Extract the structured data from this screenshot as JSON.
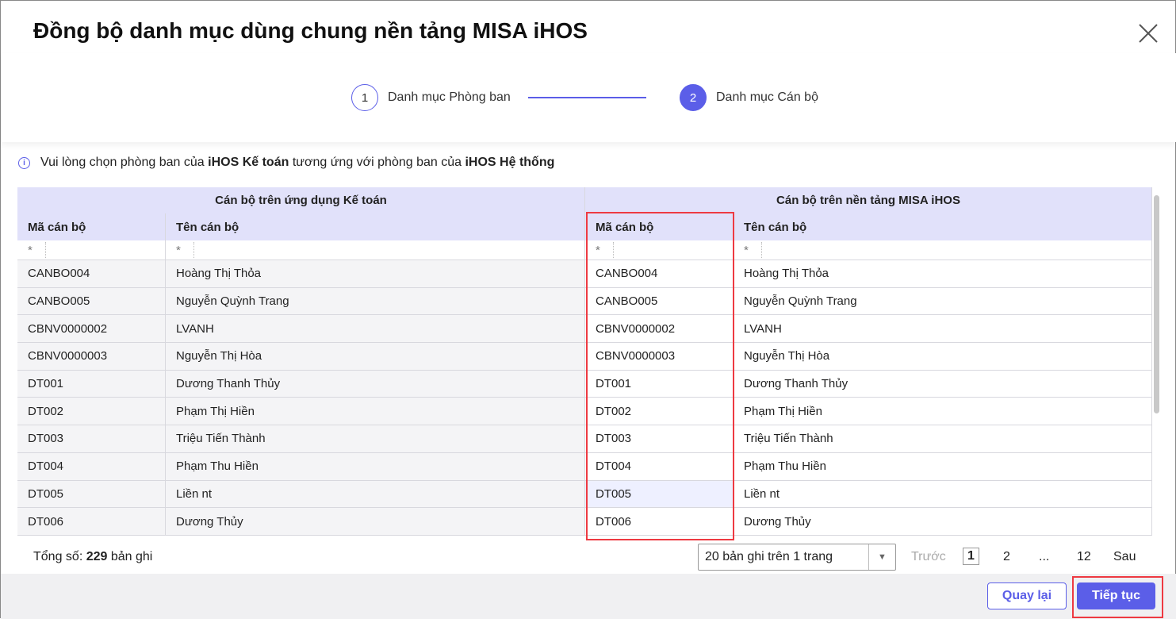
{
  "dialog": {
    "title": "Đồng bộ danh mục dùng chung nền tảng MISA iHOS"
  },
  "steps": [
    {
      "number": "1",
      "label": "Danh mục Phòng ban"
    },
    {
      "number": "2",
      "label": "Danh mục Cán bộ"
    }
  ],
  "info": {
    "text1": "Vui lòng chọn phòng ban của ",
    "bold1": "iHOS Kế toán",
    "text2": " tương ứng với phòng ban của ",
    "bold2": "iHOS Hệ thống"
  },
  "table": {
    "group_left": "Cán bộ trên ứng dụng Kế toán",
    "group_right": "Cán bộ trên nền tảng MISA iHOS",
    "columns": [
      "Mã cán bộ",
      "Tên cán bộ",
      "Mã cán bộ",
      "Tên cán bộ"
    ],
    "filter": "*",
    "rows": [
      [
        "CANBO004",
        "Hoàng Thị Thỏa",
        "CANBO004",
        "Hoàng Thị Thỏa"
      ],
      [
        "CANBO005",
        "Nguyễn Quỳnh Trang",
        "CANBO005",
        "Nguyễn Quỳnh Trang"
      ],
      [
        "CBNV0000002",
        "LVANH",
        "CBNV0000002",
        "LVANH"
      ],
      [
        "CBNV0000003",
        "Nguyễn Thị Hòa",
        "CBNV0000003",
        "Nguyễn Thị Hòa"
      ],
      [
        "DT001",
        "Dương Thanh Thủy",
        "DT001",
        "Dương Thanh Thủy"
      ],
      [
        "DT002",
        "Phạm Thị Hiền",
        "DT002",
        "Phạm Thị Hiền"
      ],
      [
        "DT003",
        "Triệu Tiến Thành",
        "DT003",
        "Triệu Tiến Thành"
      ],
      [
        "DT004",
        "Phạm Thu Hiền",
        "DT004",
        "Phạm Thu Hiền"
      ],
      [
        "DT005",
        "Liền nt",
        "DT005",
        "Liền nt"
      ],
      [
        "DT006",
        "Dương Thủy",
        "DT006",
        "Dương Thủy"
      ]
    ]
  },
  "pager": {
    "total_label": "Tổng số: ",
    "total": "229",
    "total_suffix": " bản ghi",
    "page_size": "20 bản ghi trên 1 trang",
    "prev": "Trước",
    "pages": [
      "1",
      "2",
      "...",
      "12"
    ],
    "next": "Sau"
  },
  "buttons": {
    "back": "Quay lại",
    "continue": "Tiếp tục"
  }
}
